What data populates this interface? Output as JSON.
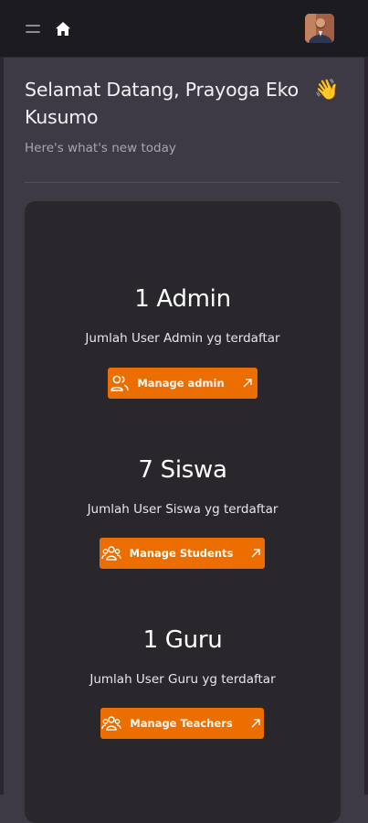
{
  "header": {
    "menu_icon": "hamburger-menu-icon",
    "home_icon": "home-icon",
    "avatar_icon": "user-avatar"
  },
  "welcome": {
    "title": "Selamat Datang, Prayoga Eko Kusumo",
    "emoji": "👋",
    "subtitle": "Here's what's new today"
  },
  "stats": [
    {
      "title": "1 Admin",
      "description": "Jumlah User Admin yg terdaftar",
      "button_label": "Manage admin",
      "button_icon": "users-icon",
      "arrow_icon": "arrow-up-right-icon"
    },
    {
      "title": "7 Siswa",
      "description": "Jumlah User Siswa yg terdaftar",
      "button_label": "Manage Students",
      "button_icon": "user-group-icon",
      "arrow_icon": "arrow-up-right-icon"
    },
    {
      "title": "1 Guru",
      "description": "Jumlah User Guru yg terdaftar",
      "button_label": "Manage Teachers",
      "button_icon": "user-group-icon",
      "arrow_icon": "arrow-up-right-icon"
    }
  ],
  "colors": {
    "accent": "#ec6d00",
    "background": "#3e3a45",
    "card": "#29272c",
    "topbar": "#1c1b1f"
  }
}
